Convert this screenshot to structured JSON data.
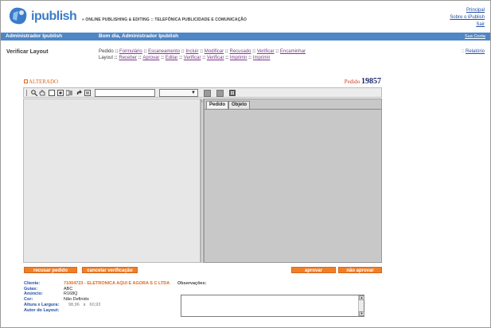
{
  "header": {
    "logo_text": "ipublish",
    "tagline": "» ONLINE PUBLISHING & EDITING  ::  TELEFÔNICA PUBLICIDADE E COMUNICAÇÃO",
    "links": [
      "Principal",
      "Sobre o iPublish",
      "Sair"
    ]
  },
  "userbar": {
    "admin": "Administrador Ipublish",
    "greeting": "Bom dia, Administrador Ipublish",
    "right_link": "Sua Conta"
  },
  "section": {
    "title": "Verificar Layout",
    "relatorio": "Relatório",
    "steps_line1": [
      {
        "label": "Pedido",
        "link": false
      },
      {
        "label": "Formulário",
        "link": true
      },
      {
        "label": "Escaneamento",
        "link": true
      },
      {
        "label": "Incluir",
        "link": true
      },
      {
        "label": "Modificar",
        "link": true
      },
      {
        "label": "Recusado",
        "link": true
      },
      {
        "label": "Verificar",
        "link": true
      },
      {
        "label": "Encaminhar",
        "link": true
      }
    ],
    "steps_line2": [
      {
        "label": "Layout",
        "link": false
      },
      {
        "label": "Receber",
        "link": true
      },
      {
        "label": "Aprovar",
        "link": true
      },
      {
        "label": "Editar",
        "link": true
      },
      {
        "label": "Verificar",
        "link": true
      },
      {
        "label": "Verificar",
        "link": true
      },
      {
        "label": "Imprimir",
        "link": true
      },
      {
        "label": "Imprimir",
        "link": true
      }
    ]
  },
  "status": {
    "alterado": "ALTERADO",
    "pedido_label": "Pedido",
    "pedido_number": "19857"
  },
  "toolbar": {
    "text_value": "",
    "select_value": ""
  },
  "tabs": [
    "Pedido",
    "Objeto"
  ],
  "buttons": {
    "recusar": "recusar pedido",
    "cancelar": "cancelar verificação",
    "aprovar": "aprovar",
    "nao_aprovar": "não aprovar"
  },
  "info": {
    "cliente_label": "Cliente:",
    "cliente_value": "71004723 - ELETRONICA AQUI E AGORA S C LTDA",
    "guias_label": "Guias:",
    "guias_value": "ABC",
    "anuncio_label": "Anúncio:",
    "anuncio_value": "R168Q",
    "cor_label": "Cor:",
    "cor_value": "Não Definido",
    "altura_label": "Altura x Largura:",
    "altura_value": "98,96",
    "x": "x",
    "largura_value": "60,93",
    "autor_label": "Autor do Layout:",
    "obs_label": "Observações:",
    "obs_value": ""
  }
}
